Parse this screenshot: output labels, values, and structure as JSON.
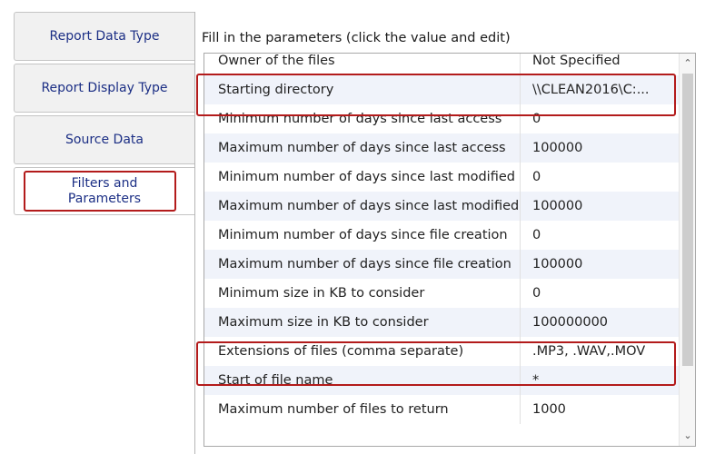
{
  "tabs": [
    {
      "label": "Report Data Type",
      "active": false
    },
    {
      "label": "Report Display Type",
      "active": false
    },
    {
      "label": "Source Data",
      "active": false
    },
    {
      "label": "Filters and\nParameters",
      "active": true
    }
  ],
  "instruction": "Fill in the parameters (click the value and edit)",
  "params": [
    {
      "name": "Owner of the files",
      "value": "Not Specified"
    },
    {
      "name": "Starting directory",
      "value": "\\\\CLEAN2016\\C:..."
    },
    {
      "name": "Minimum number of days since last access",
      "value": "0"
    },
    {
      "name": "Maximum number of days since last access",
      "value": "100000"
    },
    {
      "name": "Minimum number of days since last modified",
      "value": "0"
    },
    {
      "name": "Maximum number of days since last modified",
      "value": "100000"
    },
    {
      "name": "Minimum number of days since file creation",
      "value": "0"
    },
    {
      "name": "Maximum number of days since file creation",
      "value": "100000"
    },
    {
      "name": "Minimum size in KB to consider",
      "value": "0"
    },
    {
      "name": "Maximum size in KB to consider",
      "value": "100000000"
    },
    {
      "name": "Extensions of files (comma separate)",
      "value": ".MP3, .WAV,.MOV"
    },
    {
      "name": "Start of file name",
      "value": "*"
    },
    {
      "name": "Maximum number of files to return",
      "value": "1000"
    }
  ],
  "scrollbar": {
    "up_icon": "chevron-up-icon",
    "down_icon": "chevron-down-icon"
  },
  "colors": {
    "highlight": "#b31b1b",
    "tab_text": "#1c2f85",
    "alt_row": "#f0f3fa"
  }
}
